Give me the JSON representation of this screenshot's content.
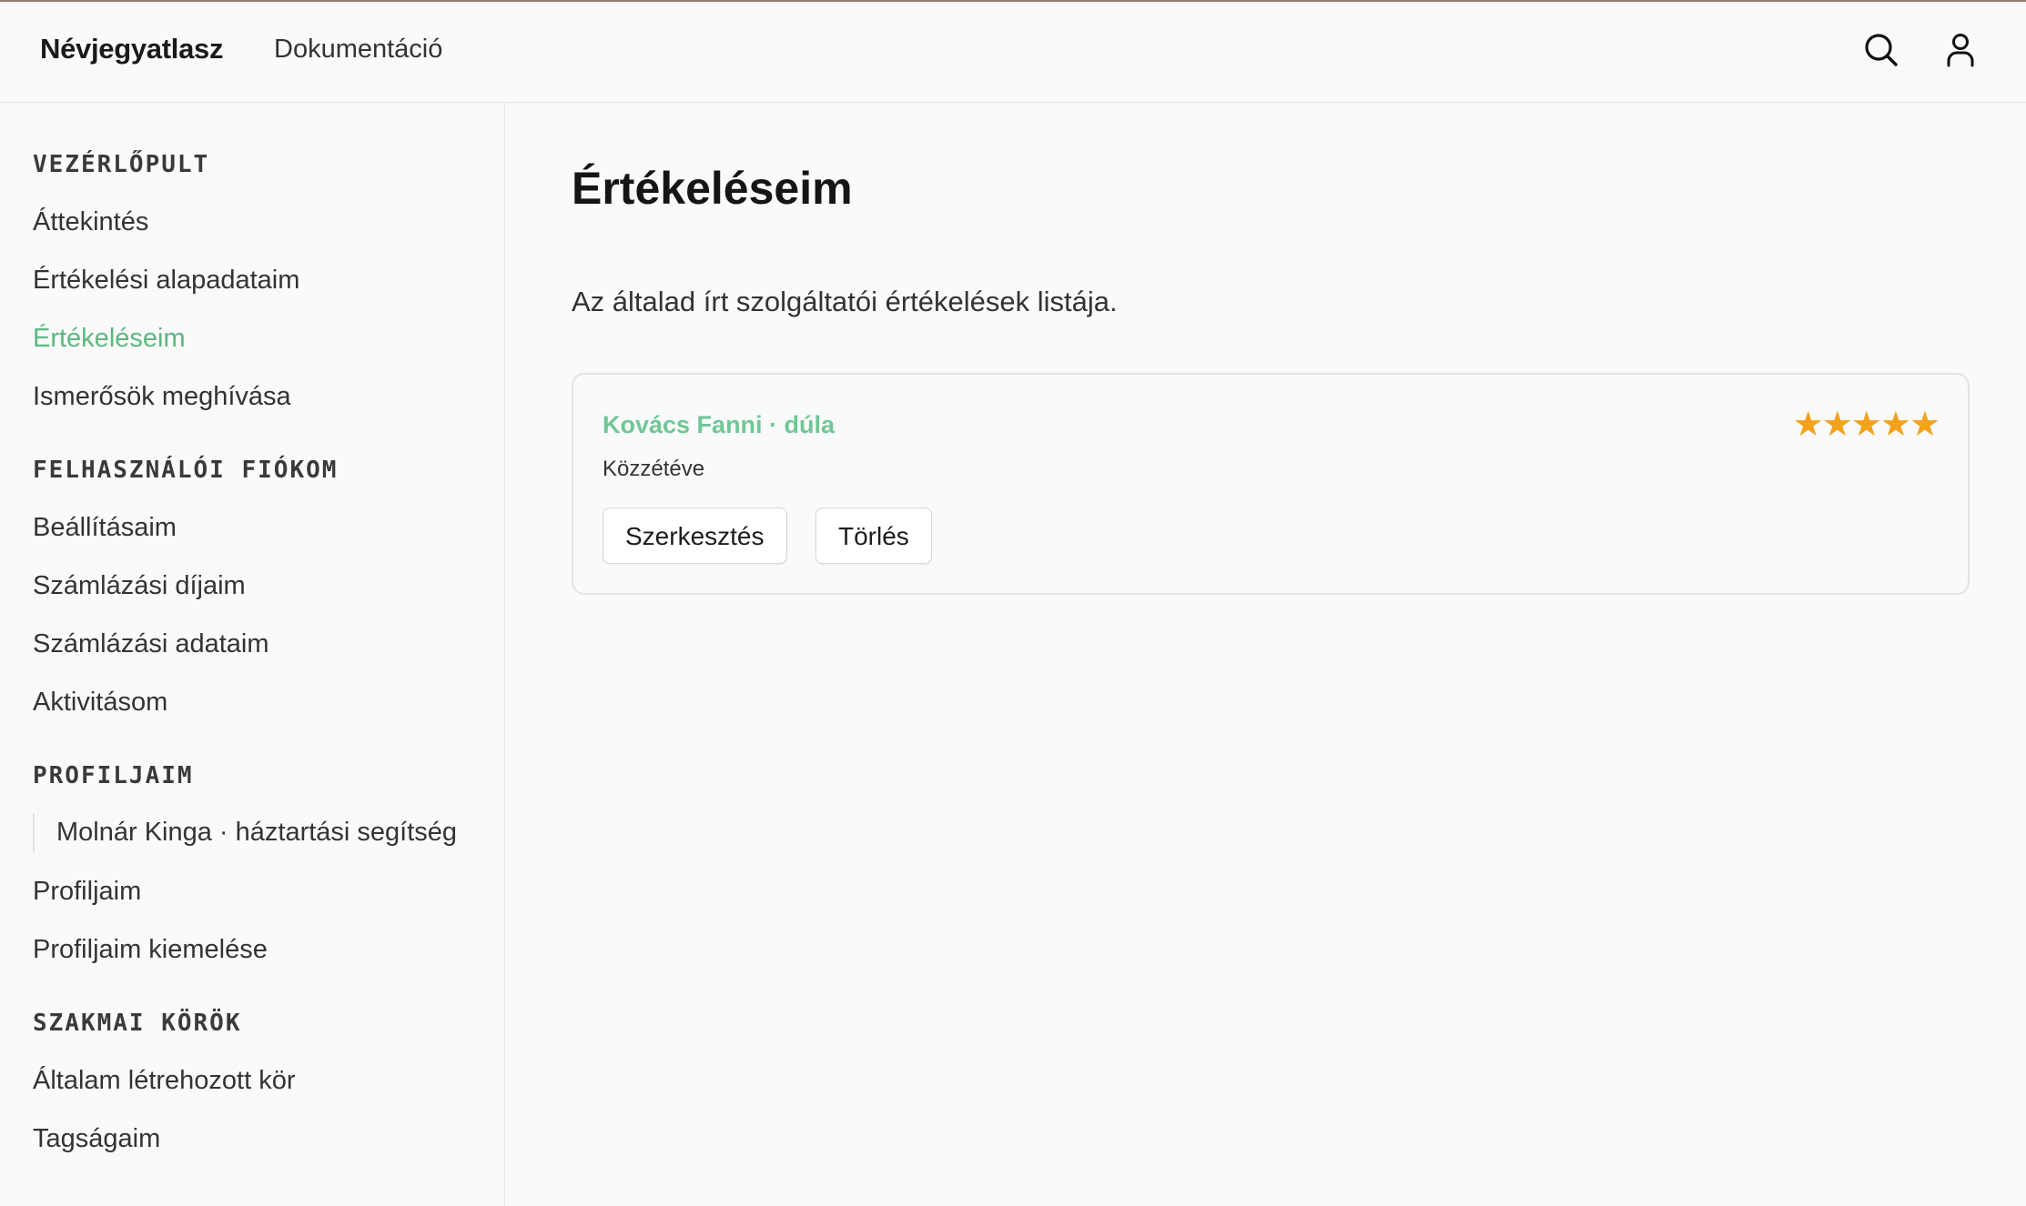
{
  "header": {
    "brand": "Névjegyatlasz",
    "nav_docs": "Dokumentáció",
    "icons": {
      "search": "search-icon",
      "user": "user-icon"
    }
  },
  "sidebar": {
    "sections": [
      {
        "title": "VEZÉRLŐPULT",
        "items": [
          {
            "label": "Áttekintés"
          },
          {
            "label": "Értékelési alapadataim"
          },
          {
            "label": "Értékeléseim",
            "active": true
          },
          {
            "label": "Ismerősök meghívása"
          }
        ]
      },
      {
        "title": "FELHASZNÁLÓI FIÓKOM",
        "items": [
          {
            "label": "Beállításaim"
          },
          {
            "label": "Számlázási díjaim"
          },
          {
            "label": "Számlázási adataim"
          },
          {
            "label": "Aktivitásom"
          }
        ]
      },
      {
        "title": "PROFILJAIM",
        "subitem": "Molnár Kinga · háztartási segítség",
        "items": [
          {
            "label": "Profiljaim"
          },
          {
            "label": "Profiljaim kiemelése"
          }
        ]
      },
      {
        "title": "SZAKMAI KÖRÖK",
        "items": [
          {
            "label": "Általam létrehozott kör"
          },
          {
            "label": "Tagságaim"
          }
        ]
      }
    ]
  },
  "main": {
    "title": "Értékeléseim",
    "subtitle": "Az általad írt szolgáltatói értékelések listája.",
    "review": {
      "title": "Kovács Fanni · dúla",
      "status": "Közzétéve",
      "rating": 5,
      "rating_max": 5,
      "stars": "★★★★★",
      "edit_label": "Szerkesztés",
      "delete_label": "Törlés"
    }
  },
  "colors": {
    "accent": "#5cb77f",
    "accent_light": "#6fc795",
    "star": "#f2a21b",
    "top_line": "#9a7b70"
  }
}
